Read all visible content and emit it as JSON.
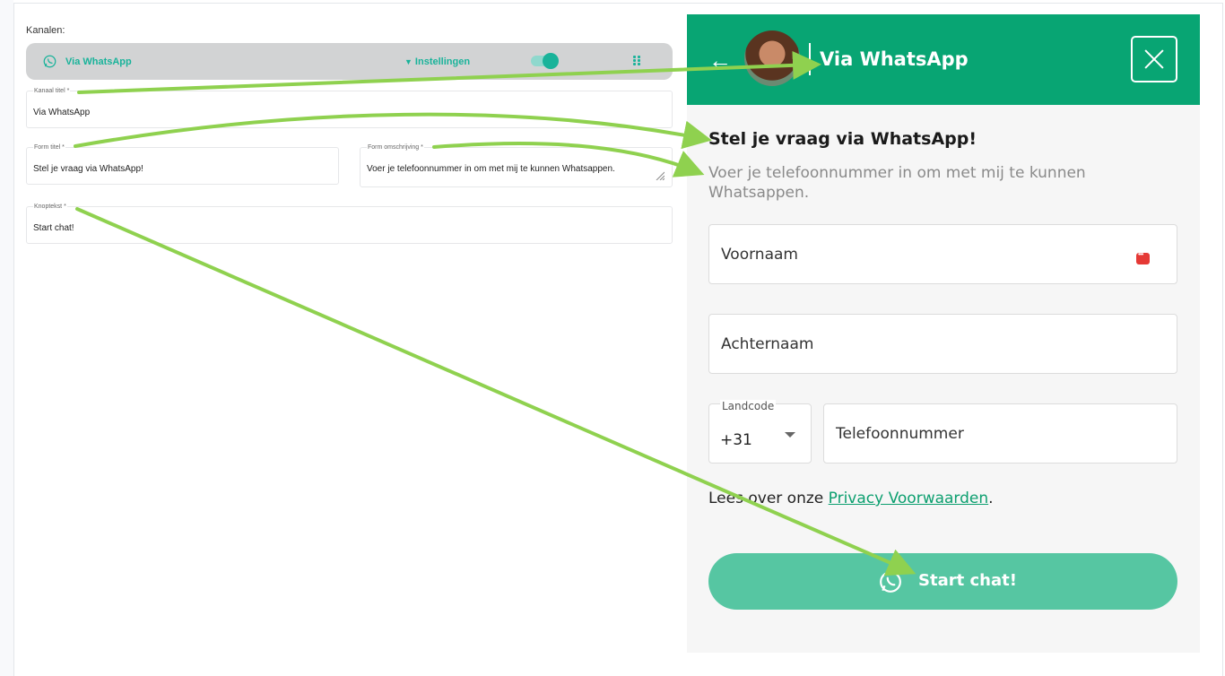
{
  "editor": {
    "section_label": "Kanalen:",
    "channel": {
      "name": "Via WhatsApp",
      "settings_label": "Instellingen",
      "enabled": true
    },
    "fields": {
      "kanaal_titel": {
        "label": "Kanaal titel *",
        "value": "Via WhatsApp"
      },
      "form_titel": {
        "label": "Form titel *",
        "value": "Stel je vraag via WhatsApp!"
      },
      "form_omschrijving": {
        "label": "Form omschrijving *",
        "value": "Voer je telefoonnummer in om met mij te kunnen Whatsappen."
      },
      "knoptekst": {
        "label": "Knoptekst *",
        "value": "Start chat!"
      }
    }
  },
  "widget": {
    "header_title": "Via WhatsApp",
    "back_icon": "arrow-left-icon",
    "close_icon": "close-icon",
    "form_title": "Stel je vraag via WhatsApp!",
    "form_description": "Voer je telefoonnummer in om met mij te kunnen Whatsappen.",
    "first_name_placeholder": "Voornaam",
    "last_name_placeholder": "Achternaam",
    "country_code_label": "Landcode",
    "country_code_value": "+31",
    "phone_placeholder": "Telefoonnummer",
    "privacy_prefix": "Lees over onze ",
    "privacy_link": "Privacy Voorwaarden",
    "privacy_suffix": ".",
    "button_label": "Start chat!"
  },
  "colors": {
    "brand_green": "#08a573",
    "accent_teal": "#19b39a",
    "button_green": "#56c6a2",
    "annotation_arrow": "#8fd14f"
  }
}
